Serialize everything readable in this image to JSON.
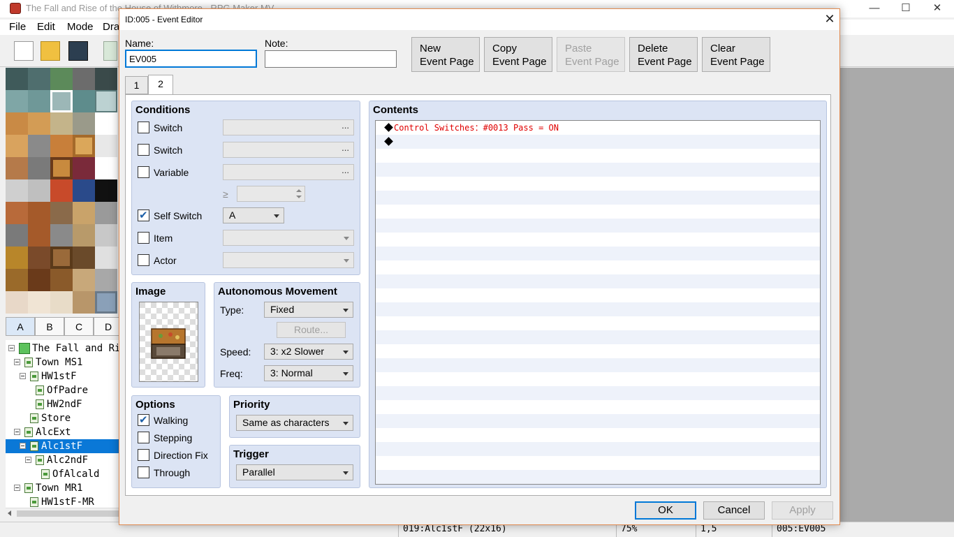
{
  "app": {
    "title": "The Fall and Rise of the House of Withmore - RPG Maker MV",
    "menu": [
      "File",
      "Edit",
      "Mode",
      "Dra"
    ],
    "window_controls": [
      "—",
      "☐",
      "✕"
    ]
  },
  "tile_tabs": [
    "A",
    "B",
    "C",
    "D"
  ],
  "map_tree": [
    {
      "label": "The Fall and Rise",
      "indent": 0,
      "type": "project"
    },
    {
      "label": "Town MS1",
      "indent": 1,
      "type": "map"
    },
    {
      "label": "HW1stF",
      "indent": 2,
      "type": "map"
    },
    {
      "label": "OfPadre",
      "indent": 3,
      "type": "map"
    },
    {
      "label": "HW2ndF",
      "indent": 3,
      "type": "map"
    },
    {
      "label": "Store",
      "indent": 2,
      "type": "map"
    },
    {
      "label": "AlcExt",
      "indent": 1,
      "type": "map"
    },
    {
      "label": "Alc1stF",
      "indent": 2,
      "type": "map",
      "selected": true
    },
    {
      "label": "Alc2ndF",
      "indent": 3,
      "type": "map"
    },
    {
      "label": "OfAlcald",
      "indent": 4,
      "type": "map"
    },
    {
      "label": "Town MR1",
      "indent": 1,
      "type": "map"
    },
    {
      "label": "HW1stF-MR",
      "indent": 2,
      "type": "map"
    }
  ],
  "status_bar": {
    "map": "019:Alc1stF (22x16)",
    "zoom": "75%",
    "coords": "1,5",
    "event": "005:EV005"
  },
  "dialog": {
    "title": "ID:005 - Event Editor",
    "close": "✕",
    "name_label": "Name:",
    "name_value": "EV005",
    "note_label": "Note:",
    "note_value": "",
    "buttons": {
      "new_page": "New\nEvent Page",
      "copy_page": "Copy\nEvent Page",
      "paste_page": "Paste\nEvent Page",
      "delete_page": "Delete\nEvent Page",
      "clear_page": "Clear\nEvent Page"
    },
    "page_tabs": [
      "1",
      "2"
    ],
    "selected_tab": "2",
    "conditions": {
      "title": "Conditions",
      "switch1": {
        "label": "Switch",
        "checked": false,
        "value": "",
        "dots": "..."
      },
      "switch2": {
        "label": "Switch",
        "checked": false,
        "value": "",
        "dots": "..."
      },
      "variable": {
        "label": "Variable",
        "checked": false,
        "value": "",
        "dots": "..."
      },
      "ge": "≥",
      "self_switch": {
        "label": "Self Switch",
        "checked": true,
        "value": "A"
      },
      "item": {
        "label": "Item",
        "checked": false,
        "value": ""
      },
      "actor": {
        "label": "Actor",
        "checked": false,
        "value": ""
      }
    },
    "image": {
      "title": "Image"
    },
    "autonomous_movement": {
      "title": "Autonomous Movement",
      "type_label": "Type:",
      "type_value": "Fixed",
      "route_label": "Route...",
      "speed_label": "Speed:",
      "speed_value": "3: x2 Slower",
      "freq_label": "Freq:",
      "freq_value": "3: Normal"
    },
    "options": {
      "title": "Options",
      "walking": {
        "label": "Walking",
        "checked": true
      },
      "stepping": {
        "label": "Stepping",
        "checked": false
      },
      "direction_fix": {
        "label": "Direction Fix",
        "checked": false
      },
      "through": {
        "label": "Through",
        "checked": false
      }
    },
    "priority": {
      "title": "Priority",
      "value": "Same as characters"
    },
    "trigger": {
      "title": "Trigger",
      "value": "Parallel"
    },
    "contents": {
      "title": "Contents",
      "lines": [
        {
          "marker": "◆",
          "text": "Control Switches：#0013 Pass = ON"
        },
        {
          "marker": "◆",
          "text": ""
        }
      ]
    },
    "footer": {
      "ok": "OK",
      "cancel": "Cancel",
      "apply": "Apply"
    }
  }
}
